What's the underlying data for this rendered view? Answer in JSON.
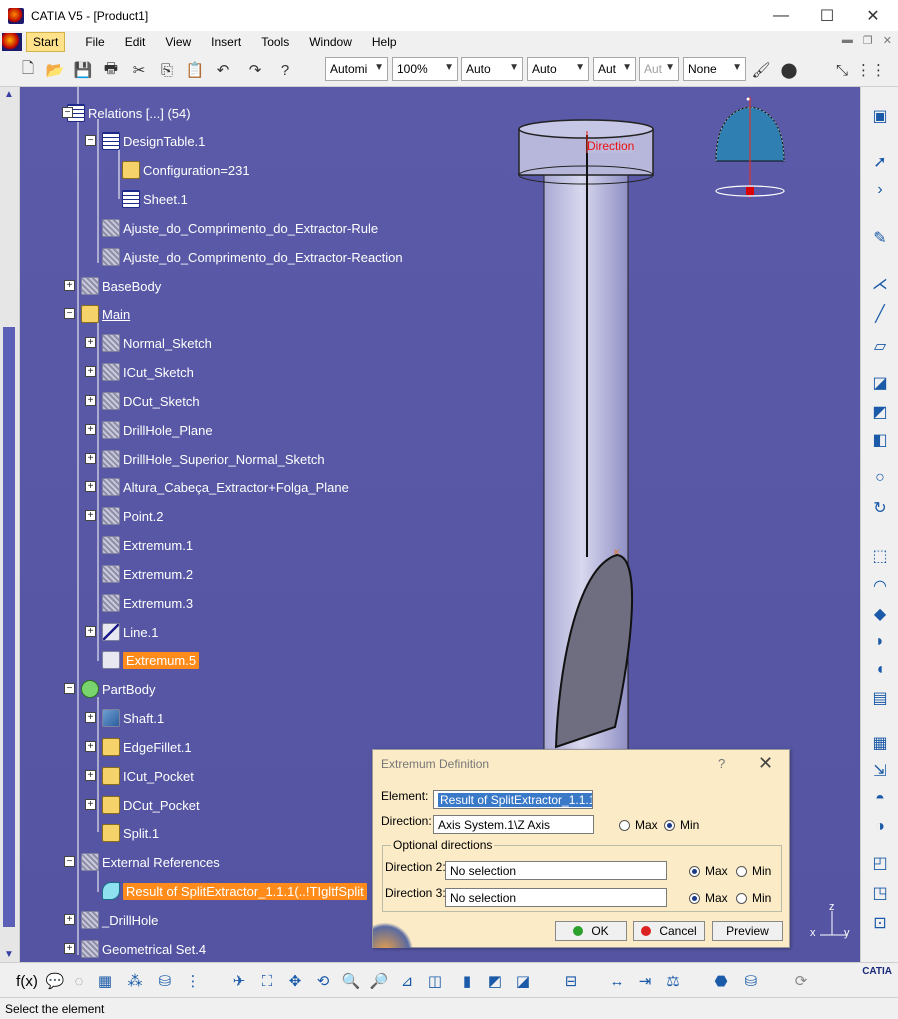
{
  "window": {
    "title": "CATIA V5 - [Product1]",
    "controls": {
      "minimize": "—",
      "maximize": "☐",
      "close": "✕"
    }
  },
  "menubar": {
    "items": [
      "Start",
      "File",
      "Edit",
      "View",
      "Insert",
      "Tools",
      "Window",
      "Help"
    ],
    "underlined": [
      "S",
      "F",
      "E",
      "V",
      "I",
      "T",
      "W",
      "H"
    ]
  },
  "toolbar": {
    "selectors": [
      {
        "value": "Automi"
      },
      {
        "value": "100%"
      },
      {
        "value": "Auto"
      },
      {
        "value": "Auto"
      },
      {
        "value": "Aut"
      },
      {
        "value": "Aut",
        "disabled": true
      },
      {
        "value": "None"
      }
    ]
  },
  "tree": {
    "rows": [
      {
        "label": "Relations [...] (54)",
        "icon": "relations-icon"
      },
      {
        "label": "DesignTable.1",
        "icon": "design-table-icon"
      },
      {
        "label": "Configuration=231",
        "icon": "configuration-icon"
      },
      {
        "label": "Sheet.1",
        "icon": "sheet-icon"
      },
      {
        "label": "Ajuste_do_Comprimento_do_Extractor-Rule",
        "icon": "rule-icon"
      },
      {
        "label": "Ajuste_do_Comprimento_do_Extractor-Reaction",
        "icon": "reaction-icon"
      },
      {
        "label": "BaseBody",
        "icon": "body-icon"
      },
      {
        "label": "Main",
        "icon": "geometrical-set-icon"
      },
      {
        "label": "Normal_Sketch",
        "icon": "sketch-icon"
      },
      {
        "label": "ICut_Sketch",
        "icon": "sketch-icon"
      },
      {
        "label": "DCut_Sketch",
        "icon": "sketch-icon"
      },
      {
        "label": "DrillHole_Plane",
        "icon": "plane-icon"
      },
      {
        "label": "DrillHole_Superior_Normal_Sketch",
        "icon": "sketch-icon"
      },
      {
        "label": "Altura_Cabeça_Extractor+Folga_Plane",
        "icon": "plane-icon"
      },
      {
        "label": "Point.2",
        "icon": "point-icon"
      },
      {
        "label": "Extremum.1",
        "icon": "extremum-icon"
      },
      {
        "label": "Extremum.2",
        "icon": "extremum-icon"
      },
      {
        "label": "Extremum.3",
        "icon": "extremum-icon"
      },
      {
        "label": "Line.1",
        "icon": "line-icon"
      },
      {
        "label": "Extremum.5",
        "icon": "extremum-icon",
        "highlighted": true
      },
      {
        "label": "PartBody",
        "icon": "part-body-icon"
      },
      {
        "label": "Shaft.1",
        "icon": "shaft-icon"
      },
      {
        "label": "EdgeFillet.1",
        "icon": "edge-fillet-icon"
      },
      {
        "label": "ICut_Pocket",
        "icon": "pocket-icon"
      },
      {
        "label": "DCut_Pocket",
        "icon": "pocket-icon"
      },
      {
        "label": "Split.1",
        "icon": "split-icon"
      },
      {
        "label": "External References",
        "icon": "external-references-icon"
      },
      {
        "label": "Result of SplitExtractor_1.1.1(..!TIgltfSplit",
        "icon": "surface-icon",
        "highlighted": true
      },
      {
        "label": "_DrillHole",
        "icon": "body-icon"
      },
      {
        "label": "Geometrical Set.4",
        "icon": "geometrical-set-icon"
      }
    ]
  },
  "viewer": {
    "direction_label": "Direction"
  },
  "axis": {
    "x": "x",
    "y": "y",
    "z": "z"
  },
  "dialog": {
    "title": "Extremum Definition",
    "help": "?",
    "close": "✕",
    "element_label": "Element:",
    "element_value": "Result of SplitExtractor_1.1.1",
    "direction_label": "Direction:",
    "direction_value": "Axis System.1\\Z Axis",
    "max_label": "Max",
    "min_label": "Min",
    "direction_choice": "Min",
    "optional_title": "Optional directions",
    "direction2_label": "Direction 2:",
    "direction2_value": "No selection",
    "direction2_choice": "Max",
    "direction3_label": "Direction 3:",
    "direction3_value": "No selection",
    "direction3_choice": "Max",
    "ok_label": "OK",
    "cancel_label": "Cancel",
    "preview_label": "Preview"
  },
  "bottom_logo": "CATIA",
  "status": {
    "message": "Select the element"
  }
}
